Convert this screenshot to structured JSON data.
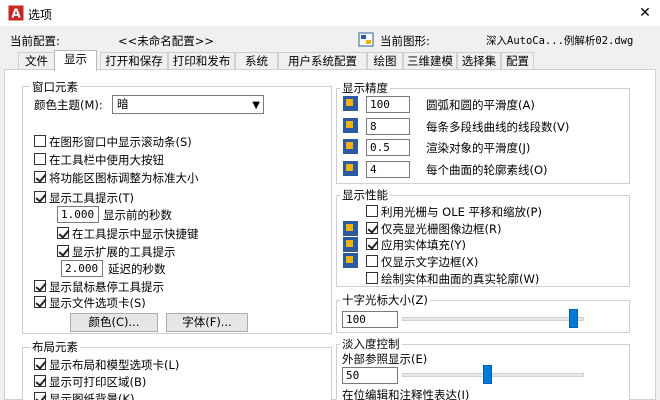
{
  "window": {
    "title": "选项",
    "close": "✕"
  },
  "config": {
    "current_profile_label": "当前配置:",
    "current_profile_value": "<<未命名配置>>",
    "current_drawing_label": "当前图形:",
    "current_drawing_value": "深入AutoCa...例解析02.dwg"
  },
  "tabs": [
    "文件",
    "显示",
    "打开和保存",
    "打印和发布",
    "系统",
    "用户系统配置",
    "绘图",
    "三维建模",
    "选择集",
    "配置"
  ],
  "window_elements": {
    "title": "窗口元素",
    "color_theme_label": "颜色主题(M):",
    "color_theme_value": "暗",
    "show_scrollbars": "在图形窗口中显示滚动条(S)",
    "large_buttons": "在工具栏中使用大按钮",
    "resize_icons": "将功能区图标调整为标准大小",
    "show_tooltips": "显示工具提示(T)",
    "delay_value": "1.000",
    "delay_label": "显示前的秒数",
    "shortcut_in_tooltips": "在工具提示中显示快捷键",
    "extended_tooltips": "显示扩展的工具提示",
    "ext_delay_value": "2.000",
    "ext_delay_label": "延迟的秒数",
    "rollover_tooltips": "显示鼠标悬停工具提示",
    "file_tabs": "显示文件选项卡(S)",
    "colors_button": "颜色(C)...",
    "fonts_button": "字体(F)..."
  },
  "layout_elements": {
    "title": "布局元素",
    "layout_model_tabs": "显示布局和模型选项卡(L)",
    "printable_area": "显示可打印区域(B)",
    "paper_background": "显示图纸背景(K)"
  },
  "display_resolution": {
    "title": "显示精度",
    "arc_value": "100",
    "arc_label": "圆弧和圆的平滑度(A)",
    "polyline_value": "8",
    "polyline_label": "每条多段线曲线的线段数(V)",
    "render_value": "0.5",
    "render_label": "渲染对象的平滑度(J)",
    "contour_value": "4",
    "contour_label": "每个曲面的轮廓素线(O)"
  },
  "display_performance": {
    "title": "显示性能",
    "raster_ole": "利用光栅与 OLE 平移和缩放(P)",
    "raster_frame": "仅亮显光栅图像边框(R)",
    "solid_fill": "应用实体填充(Y)",
    "text_frame": "仅显示文字边框(X)",
    "silhouettes": "绘制实体和曲面的真实轮廓(W)"
  },
  "crosshair": {
    "title": "十字光标大小(Z)",
    "value": "100",
    "slider_fraction": 1.0
  },
  "fade": {
    "title": "淡入度控制",
    "xref_label": "外部参照显示(E)",
    "xref_value": "50",
    "xref_slider_fraction": 0.5,
    "inplace_label": "在位编辑和注释性表达(I)"
  },
  "colors": {
    "accent": "#007ad9",
    "icon_blue": "#2c5aa0",
    "icon_gold": "#f0b400"
  }
}
